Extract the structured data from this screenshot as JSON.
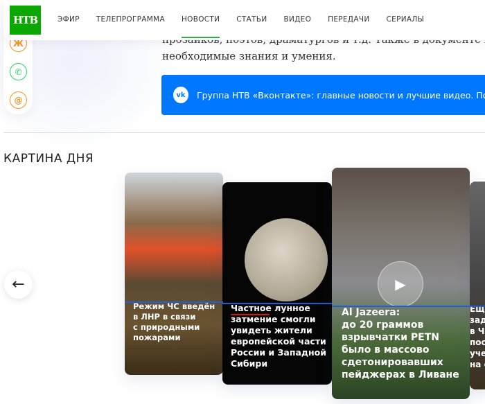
{
  "header": {
    "logo": "НТВ",
    "nav": [
      "ЭФИР",
      "ТЕЛЕПРОГРАММА",
      "НОВОСТИ",
      "СТАТЬИ",
      "ВИДЕО",
      "ПЕРЕДАЧИ",
      "СЕРИАЛЫ"
    ],
    "active": "НОВОСТИ"
  },
  "social": [
    {
      "icon": "odnoklassniki-icon",
      "glyph": "Ж",
      "color": "#f7931e"
    },
    {
      "icon": "whatsapp-icon",
      "glyph": "✆",
      "color": "#25d366"
    },
    {
      "icon": "mail-icon",
      "glyph": "@",
      "color": "#f7931e"
    }
  ],
  "article": {
    "line1": "прозаиков, поэтов, драматургов и т.д. Также в документе про",
    "line2": "необходимые знания и умения."
  },
  "vk_banner": {
    "icon": "vk-icon",
    "glyph": "vk",
    "text": "Группа НТВ «Вконтакте»: главные новости и лучшие видео. Под"
  },
  "section": {
    "title": "КАРТИНА ДНЯ",
    "prev_arrow": "←"
  },
  "cards": [
    {
      "title": "Режим ЧС введён\nв ЛНР в связи\nс природными\nпожарами"
    },
    {
      "title": "Частное лунное\nзатмение смогли\nувидеть жители\nевропейской части\nРоссии и Западной\nСибири"
    },
    {
      "title": "Al Jazeera:\nдо 20 граммов\nвзрывчатки PETN\nбыло в массово\nсдетонировавших\nпейджерах в Ливане",
      "play": "▶"
    },
    {
      "title": "Ещё\nзаде\nв Че\nпоса\nучен\nна с"
    }
  ]
}
